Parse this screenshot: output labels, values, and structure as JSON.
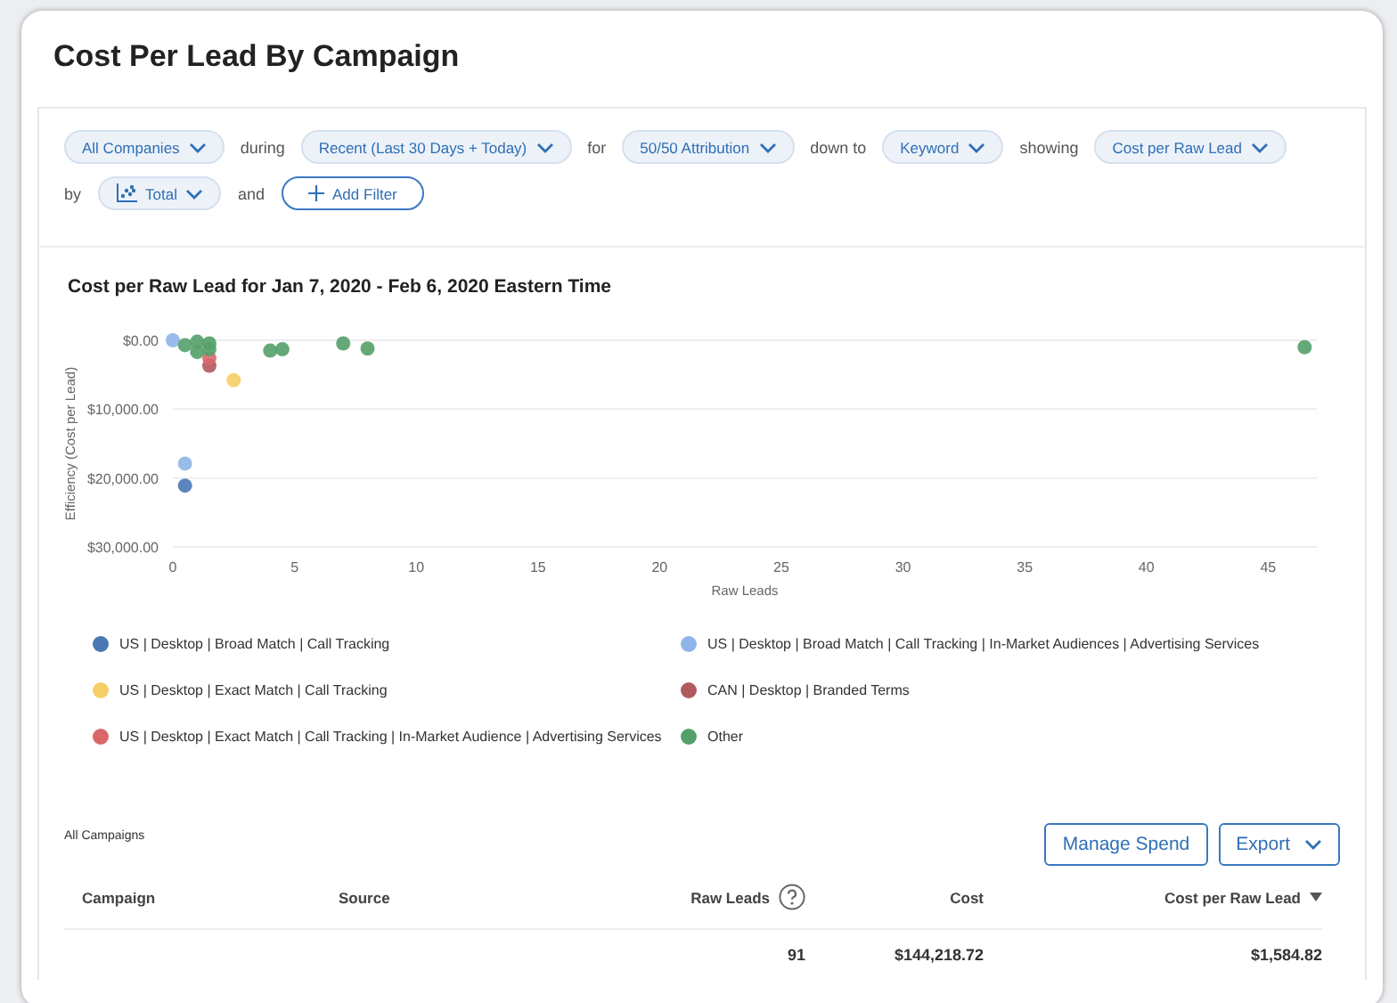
{
  "title": "Cost Per Lead By Campaign",
  "filter_rows": [
    [
      {
        "kind": "dropdown",
        "label": "All Companies"
      },
      {
        "kind": "word",
        "text": "during"
      },
      {
        "kind": "dropdown",
        "label": "Recent (Last 30 Days + Today)"
      },
      {
        "kind": "word",
        "text": "for"
      },
      {
        "kind": "dropdown",
        "label": "50/50 Attribution"
      },
      {
        "kind": "word",
        "text": "down to"
      },
      {
        "kind": "dropdown",
        "label": "Keyword"
      },
      {
        "kind": "word",
        "text": "showing"
      },
      {
        "kind": "dropdown",
        "label": "Cost per Raw Lead"
      }
    ],
    [
      {
        "kind": "word",
        "text": "by"
      },
      {
        "kind": "chart_dropdown",
        "label": "Total"
      },
      {
        "kind": "word",
        "text": "and"
      },
      {
        "kind": "add",
        "label": "Add Filter"
      }
    ]
  ],
  "chart": {
    "title": "Cost per Raw Lead for Jan 7, 2020 - Feb 6, 2020 Eastern Time",
    "chart_data": {
      "type": "scatter",
      "xlabel": "Raw Leads",
      "ylabel": "Efficiency (Cost per Lead)",
      "xlim": [
        0,
        47
      ],
      "ylim": [
        30000,
        0
      ],
      "xticks": [
        0,
        5,
        10,
        15,
        20,
        25,
        30,
        35,
        40,
        45
      ],
      "yticks": [
        {
          "value": 0,
          "label": "$0.00"
        },
        {
          "value": 10000,
          "label": "$10,000.00"
        },
        {
          "value": 20000,
          "label": "$20,000.00"
        },
        {
          "value": 30000,
          "label": "$30,000.00"
        }
      ],
      "series": [
        {
          "name": "US | Desktop | Broad Match | Call Tracking",
          "color": "#4a78b5",
          "x": [
            0.5
          ],
          "values": [
            21100
          ]
        },
        {
          "name": "US | Desktop | Broad Match | Call Tracking | In-Market Audiences | Advertising Services",
          "color": "#8fb5e8",
          "x": [
            0.5,
            0
          ],
          "values": [
            17900,
            0
          ]
        },
        {
          "name": "US | Desktop | Exact Match | Call Tracking",
          "color": "#f5cf66",
          "x": [
            2.5
          ],
          "values": [
            5800
          ]
        },
        {
          "name": "CAN | Desktop | Branded Terms",
          "color": "#b05a5e",
          "x": [
            1.5
          ],
          "values": [
            3700
          ]
        },
        {
          "name": "US | Desktop | Exact Match | Call Tracking | In-Market Audience | Advertising Services",
          "color": "#d9676a",
          "x": [
            1.5
          ],
          "values": [
            2600
          ]
        },
        {
          "name": "Other",
          "color": "#55a06a",
          "x": [
            0.5,
            1,
            1.5,
            1.5,
            1,
            4,
            4.5,
            7,
            8,
            46.5
          ],
          "values": [
            700,
            200,
            450,
            1300,
            1700,
            1500,
            1300,
            450,
            1200,
            1000
          ]
        }
      ]
    }
  },
  "table": {
    "title": "All Campaigns",
    "buttons": [
      {
        "label": "Manage Spend",
        "kind": "plain"
      },
      {
        "label": "Export",
        "kind": "dropdown"
      }
    ],
    "columns": [
      {
        "label": "Campaign",
        "help": false,
        "sorted": false
      },
      {
        "label": "Source",
        "help": false,
        "sorted": false
      },
      {
        "label": "Raw Leads",
        "help": true,
        "sorted": false
      },
      {
        "label": "Cost",
        "help": false,
        "sorted": false
      },
      {
        "label": "Cost per Raw Lead",
        "help": false,
        "sorted": true
      }
    ],
    "total_row": {
      "raw_leads": "91",
      "cost": "$144,218.72",
      "cost_per_raw_lead": "$1,584.82"
    }
  }
}
